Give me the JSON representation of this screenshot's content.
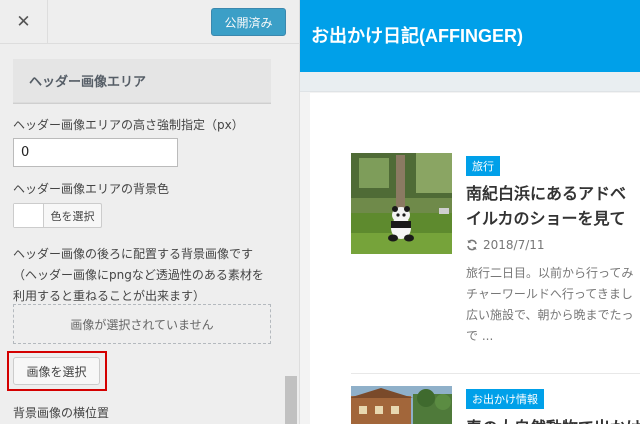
{
  "customizer": {
    "publish_label": "公開済み",
    "section_title": "ヘッダー画像エリア",
    "height_label": "ヘッダー画像エリアの高さ強制指定（px）",
    "height_value": "0",
    "bg_color_label": "ヘッダー画像エリアの背景色",
    "color_button_label": "色を選択",
    "bg_image_desc": "ヘッダー画像の後ろに配置する背景画像です（ヘッダー画像にpngなど透過性のある素材を利用すると重ねることが出来ます）",
    "no_image_text": "画像が選択されていません",
    "select_image_label": "画像を選択",
    "bg_position_label": "背景画像の横位置"
  },
  "preview": {
    "site_title": "お出かけ日記(AFFINGER)",
    "posts": [
      {
        "category": "旅行",
        "title_line1": "南紀白浜にあるアドベ",
        "title_line2": "イルカのショーを見て",
        "date": "2018/7/11",
        "excerpt_lines": [
          "旅行二日目。以前から行ってみ",
          "チャーワールドへ行ってきまし",
          "広い施設で、朝から晩までたっ",
          "で ..."
        ]
      },
      {
        "category": "お出かけ情報",
        "title_line1": "春の大自然動物で出かけ"
      }
    ]
  },
  "colors": {
    "brand_blue": "#00a0e9",
    "publish_blue": "#0085ba",
    "highlight_red": "#d40000"
  }
}
